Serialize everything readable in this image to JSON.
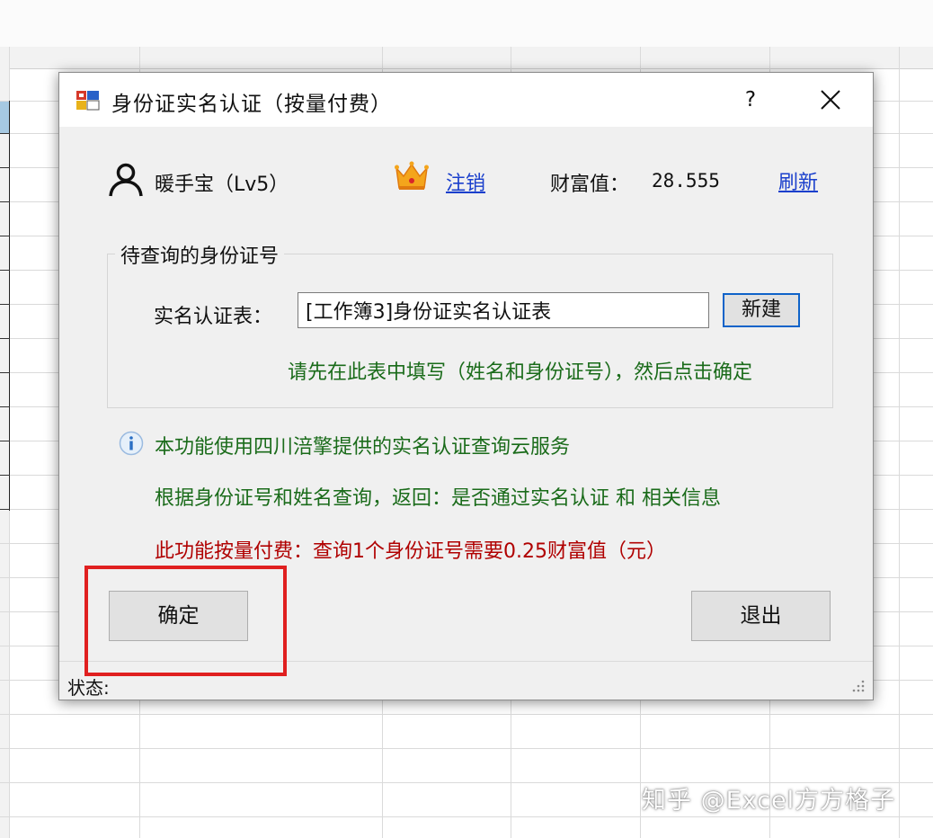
{
  "dialog": {
    "title": "身份证实名认证（按量付费）",
    "help_label": "?",
    "close_icon": "close-icon"
  },
  "account": {
    "user_name": "暖手宝（Lv5）",
    "logout_label": "注销",
    "wealth_label": "财富值：",
    "wealth_value": "28.555",
    "refresh_label": "刷新"
  },
  "id_group": {
    "title": "待查询的身份证号",
    "field_label": "实名认证表：",
    "field_value": "[工作簿3]身份证实名认证表",
    "new_button": "新建",
    "hint": "请先在此表中填写（姓名和身份证号），然后点击确定"
  },
  "info": {
    "line1": "本功能使用四川涪擎提供的实名认证查询云服务",
    "line2": "根据身份证号和姓名查询，返回：是否通过实名认证 和 相关信息",
    "price": "此功能按量付费：查询1个身份证号需要0.25财富值（元）"
  },
  "actions": {
    "ok_label": "确定",
    "exit_label": "退出"
  },
  "status": {
    "label": "状态:"
  },
  "watermark": "知乎 @Excel方方格子",
  "colors": {
    "link": "#1a3fcc",
    "green_text": "#1a6b1a",
    "red_text": "#b00000",
    "highlight": "#e02020",
    "default_button_border": "#0f63c9"
  }
}
